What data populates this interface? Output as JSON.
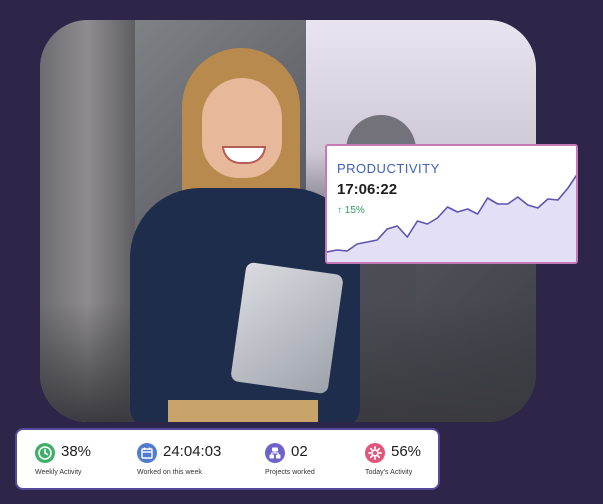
{
  "productivity": {
    "title": "PRODUCTIVITY",
    "time": "17:06:22",
    "delta": "↑ 15%",
    "trend": [
      0.12,
      0.14,
      0.13,
      0.2,
      0.22,
      0.24,
      0.35,
      0.38,
      0.27,
      0.43,
      0.4,
      0.46,
      0.57,
      0.52,
      0.55,
      0.5,
      0.66,
      0.6,
      0.6,
      0.67,
      0.59,
      0.56,
      0.65,
      0.64,
      0.76,
      0.91
    ],
    "colors": {
      "line": "#5d54b0",
      "fill": "#e3dff6",
      "border": "#c47ab7"
    }
  },
  "stats": [
    {
      "value": "38%",
      "label": "Weekly Activity",
      "icon": "clock-icon",
      "color": "#3fae6a"
    },
    {
      "value": "24:04:03",
      "label": "Worked on this week",
      "icon": "calendar-icon",
      "color": "#4f7bd0"
    },
    {
      "value": "02",
      "label": "Projects worked",
      "icon": "projects-icon",
      "color": "#6e63c9"
    },
    {
      "value": "56%",
      "label": "Today's Activity",
      "icon": "gear-icon",
      "color": "#e2557a"
    }
  ]
}
